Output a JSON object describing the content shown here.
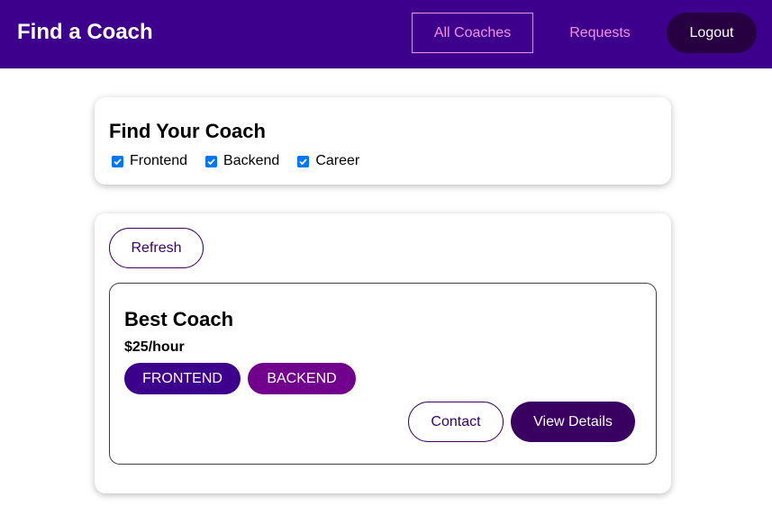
{
  "header": {
    "brand": "Find a Coach",
    "nav": {
      "all_coaches": "All Coaches",
      "requests": "Requests",
      "logout": "Logout"
    }
  },
  "filter": {
    "title": "Find Your Coach",
    "options": [
      {
        "label": "Frontend",
        "checked": true
      },
      {
        "label": "Backend",
        "checked": true
      },
      {
        "label": "Career",
        "checked": true
      }
    ]
  },
  "controls": {
    "refresh_label": "Refresh"
  },
  "coaches": [
    {
      "name": "Best Coach",
      "rate": "$25/hour",
      "areas": [
        "FRONTEND",
        "BACKEND"
      ],
      "contact_label": "Contact",
      "details_label": "View Details"
    }
  ],
  "colors": {
    "header_bg": "#3d008d",
    "nav_active": "#f391e3",
    "logout_bg": "#270041",
    "primary": "#3a0061",
    "badge_frontend": "#3d008d",
    "badge_backend": "#71008d",
    "checkbox": "#0075ff"
  }
}
